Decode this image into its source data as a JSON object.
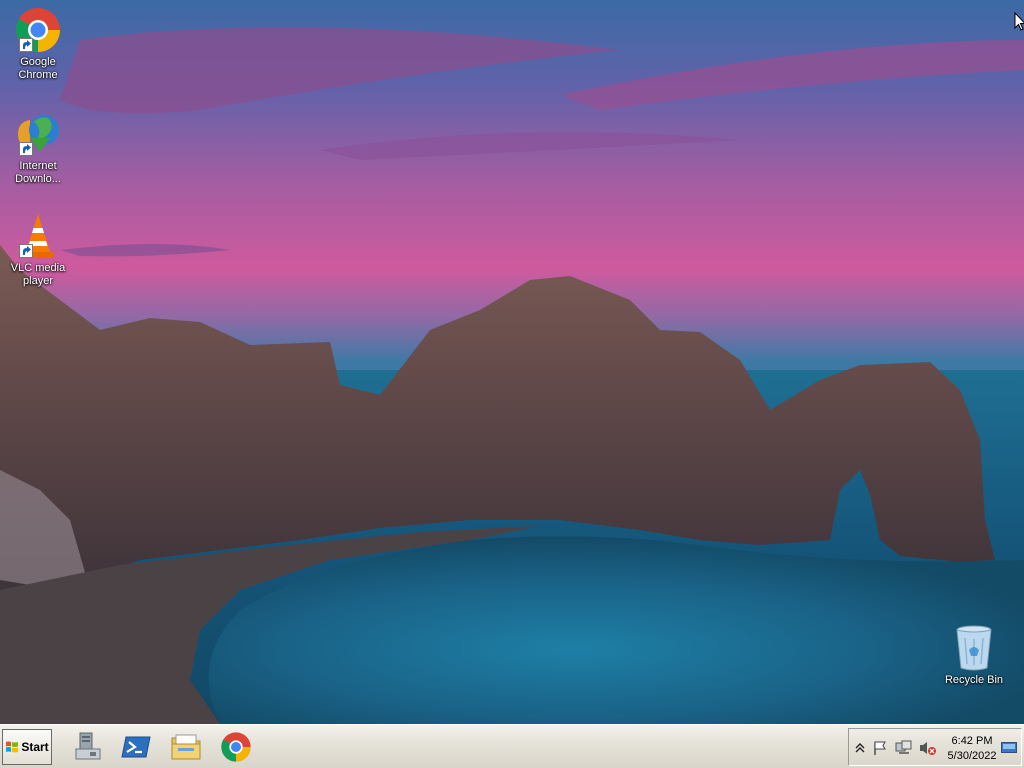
{
  "desktop": {
    "icons": [
      {
        "label": "Google Chrome",
        "icon": "chrome-icon"
      },
      {
        "label": "Internet Downlo...",
        "icon": "internet-download-manager-icon"
      },
      {
        "label": "VLC media player",
        "icon": "vlc-cone-icon"
      },
      {
        "label": "Recycle Bin",
        "icon": "recycle-bin-icon"
      }
    ]
  },
  "taskbar": {
    "start_label": "Start",
    "pinned": [
      {
        "icon": "server-manager-icon"
      },
      {
        "icon": "powershell-icon"
      },
      {
        "icon": "file-explorer-icon"
      },
      {
        "icon": "chrome-icon"
      }
    ],
    "tray": {
      "icons": [
        "show-hidden-icons-chevron",
        "action-center-flag-icon",
        "network-icon",
        "volume-muted-icon"
      ],
      "time": "6:42 PM",
      "date": "5/30/2022"
    }
  }
}
